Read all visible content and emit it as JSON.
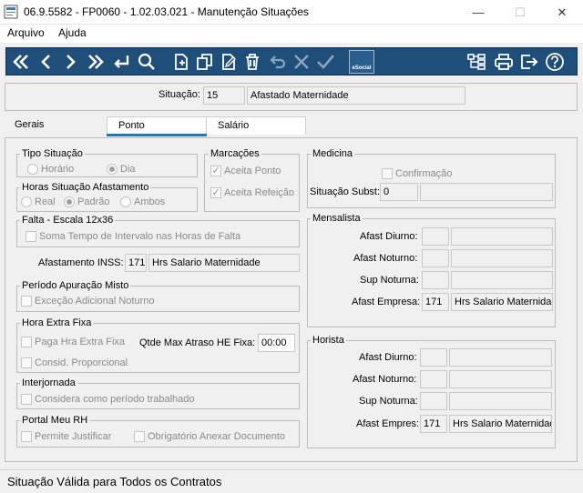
{
  "window": {
    "title": "06.9.5582 - FP0060 - 1.02.03.021 - Manutenção Situações",
    "minimize": "—",
    "maximize": "☐",
    "close": "✕"
  },
  "menu": [
    "Arquivo",
    "Ajuda"
  ],
  "toolbar": {
    "esocial_label": "eSocial",
    "icons": [
      "first-icon",
      "previous-icon",
      "next-icon",
      "last-icon",
      "enter-icon",
      "search-icon",
      "new-icon",
      "copy-icon",
      "edit-icon",
      "delete-icon",
      "undo-icon",
      "cancel-icon",
      "confirm-icon",
      "esocial-icon",
      "structure-icon",
      "print-icon",
      "exit-icon",
      "help-icon"
    ],
    "accent": "#1e4e79"
  },
  "situacao": {
    "label": "Situação:",
    "code": "15",
    "description": "Afastado Maternidade"
  },
  "tabs": [
    {
      "label": "Gerais",
      "active": false
    },
    {
      "label": "Ponto",
      "active": true
    },
    {
      "label": "Salário",
      "active": false
    }
  ],
  "tipo_situacao": {
    "title": "Tipo Situação",
    "options": [
      "Horário",
      "Dia"
    ],
    "selected": "Dia"
  },
  "horas_afastamento": {
    "title": "Horas Situação Afastamento",
    "options": [
      "Real",
      "Padrão",
      "Ambos"
    ],
    "selected": "Padrão"
  },
  "marcacoes": {
    "title": "Marcações",
    "aceita_ponto": "Aceita Ponto",
    "aceita_refeicao": "Aceita Refeição"
  },
  "falta": {
    "title": "Falta - Escala 12x36",
    "soma_tempo": "Soma Tempo de Intervalo nas Horas de Falta"
  },
  "afastamento_inss": {
    "label": "Afastamento INSS:",
    "code": "171",
    "description": "Hrs Salario Maternidade"
  },
  "periodo_apuracao": {
    "title": "Período Apuração Misto",
    "excecao": "Exceção Adicional Noturno"
  },
  "hora_extra": {
    "title": "Hora Extra Fixa",
    "paga": "Paga Hra Extra Fixa",
    "consid": "Consid. Proporcional",
    "qtde_label": "Qtde Max Atraso HE Fixa:",
    "qtde_value": "00:00"
  },
  "interjornada": {
    "title": "Interjornada",
    "considera": "Considera como período trabalhado"
  },
  "portal": {
    "title": "Portal Meu RH",
    "permite": "Permite Justificar",
    "obrigatorio": "Obrigatório Anexar Documento"
  },
  "medicina": {
    "title": "Medicina",
    "confirmacao": "Confirmação",
    "subst_label": "Situação Subst:",
    "subst_code": "0",
    "subst_desc": ""
  },
  "mensalista": {
    "title": "Mensalista",
    "diurno": "Afast Diurno:",
    "noturno": "Afast Noturno:",
    "sup_noturna": "Sup Noturna:",
    "empresa": "Afast Empresa:",
    "empresa_code": "171",
    "empresa_desc": "Hrs Salario Maternidade"
  },
  "horista": {
    "title": "Horista",
    "diurno": "Afast Diurno:",
    "noturno": "Afast Noturno:",
    "sup_noturna": "Sup Noturna:",
    "empresa": "Afast Empres:",
    "empresa_code": "171",
    "empresa_desc": "Hrs Salario Maternidade"
  },
  "status": "Situação Válida para Todos os Contratos"
}
